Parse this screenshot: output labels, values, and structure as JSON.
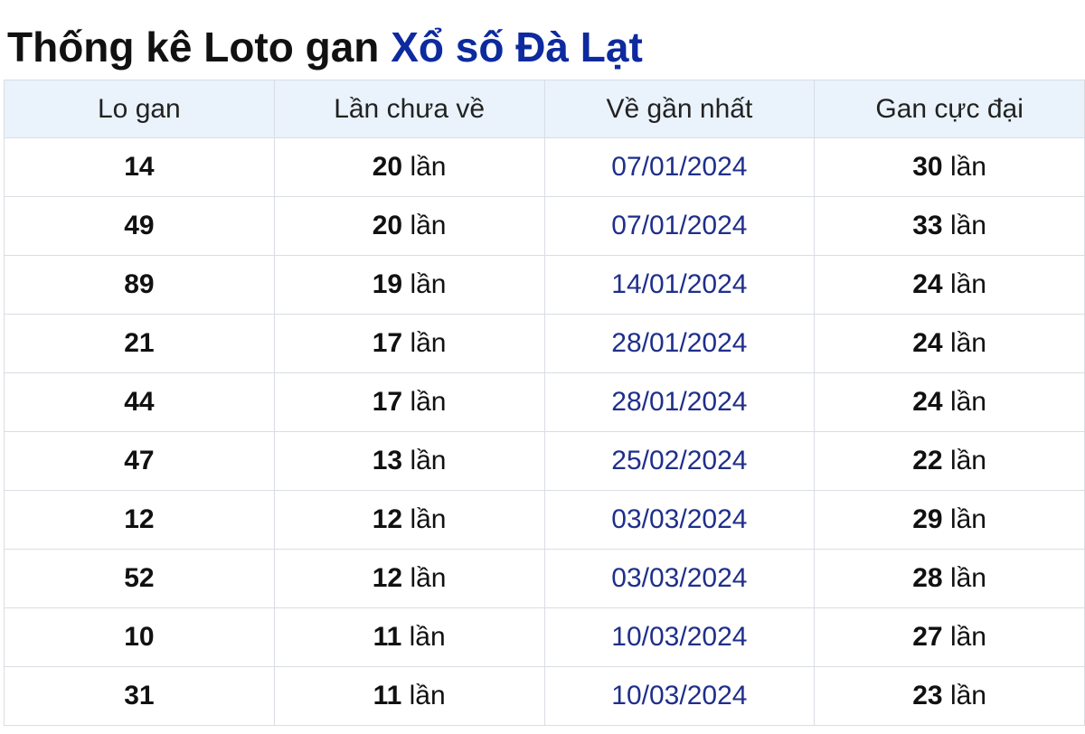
{
  "title": {
    "prefix": "Thống kê Loto gan",
    "accent": "Xổ số Đà Lạt"
  },
  "table": {
    "headers": [
      "Lo gan",
      "Lần chưa về",
      "Về gần nhất",
      "Gan cực đại"
    ],
    "unit": "lần",
    "rows": [
      {
        "lo": "14",
        "chua_ve": "20",
        "gan_nhat": "07/01/2024",
        "cuc_dai": "30"
      },
      {
        "lo": "49",
        "chua_ve": "20",
        "gan_nhat": "07/01/2024",
        "cuc_dai": "33"
      },
      {
        "lo": "89",
        "chua_ve": "19",
        "gan_nhat": "14/01/2024",
        "cuc_dai": "24"
      },
      {
        "lo": "21",
        "chua_ve": "17",
        "gan_nhat": "28/01/2024",
        "cuc_dai": "24"
      },
      {
        "lo": "44",
        "chua_ve": "17",
        "gan_nhat": "28/01/2024",
        "cuc_dai": "24"
      },
      {
        "lo": "47",
        "chua_ve": "13",
        "gan_nhat": "25/02/2024",
        "cuc_dai": "22"
      },
      {
        "lo": "12",
        "chua_ve": "12",
        "gan_nhat": "03/03/2024",
        "cuc_dai": "29"
      },
      {
        "lo": "52",
        "chua_ve": "12",
        "gan_nhat": "03/03/2024",
        "cuc_dai": "28"
      },
      {
        "lo": "10",
        "chua_ve": "11",
        "gan_nhat": "10/03/2024",
        "cuc_dai": "27"
      },
      {
        "lo": "31",
        "chua_ve": "11",
        "gan_nhat": "10/03/2024",
        "cuc_dai": "23"
      }
    ]
  },
  "colors": {
    "title_accent": "#0d2a9e",
    "date_text": "#1f2f8a",
    "header_bg": "#eaf3fc",
    "border": "#d9dde3"
  }
}
